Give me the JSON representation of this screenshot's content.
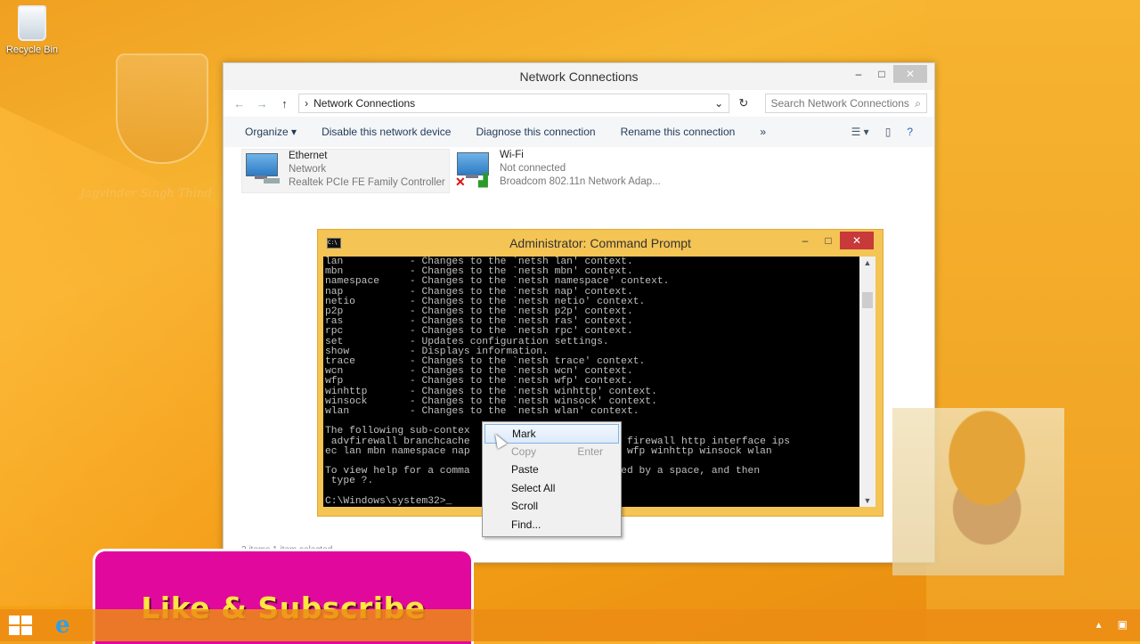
{
  "desktop": {
    "recycle_bin_label": "Recycle Bin",
    "watermark_text": "Jagvinder Singh Thind"
  },
  "explorer": {
    "title": "Network Connections",
    "breadcrumb": "Network Connections",
    "search_placeholder": "Search Network Connections",
    "commands": [
      "Organize ▾",
      "Disable this network device",
      "Diagnose this connection",
      "Rename this connection",
      "»"
    ],
    "items": [
      {
        "name": "Ethernet",
        "line2": "Network",
        "line3": "Realtek PCIe FE Family Controller"
      },
      {
        "name": "Wi-Fi",
        "line2": "Not connected",
        "line3": "Broadcom 802.11n Network Adap..."
      }
    ],
    "status": "2 items     1 item selected"
  },
  "cmd": {
    "title": "Administrator: Command Prompt",
    "output": "lan           - Changes to the `netsh lan' context.\nmbn           - Changes to the `netsh mbn' context.\nnamespace     - Changes to the `netsh namespace' context.\nnap           - Changes to the `netsh nap' context.\nnetio         - Changes to the `netsh netio' context.\np2p           - Changes to the `netsh p2p' context.\nras           - Changes to the `netsh ras' context.\nrpc           - Changes to the `netsh rpc' context.\nset           - Updates configuration settings.\nshow          - Displays information.\ntrace         - Changes to the `netsh trace' context.\nwcn           - Changes to the `netsh wcn' context.\nwfp           - Changes to the `netsh wfp' context.\nwinhttp       - Changes to the `netsh winhttp' context.\nwinsock       - Changes to the `netsh winsock' context.\nwlan          - Changes to the `netsh wlan' context.\n\nThe following sub-contex                                  \n advfirewall branchcache                 nsclient firewall http interface ips\nec lan mbn namespace nap                 race wcn wfp winhttp winsock wlan\n\nTo view help for a comma                 , followed by a space, and then\n type ?.\n\nC:\\Windows\\system32>_"
  },
  "context_menu": {
    "items": [
      {
        "label": "Mark",
        "accel": "",
        "state": "highlighted"
      },
      {
        "label": "Copy",
        "accel": "Enter",
        "state": "disabled"
      },
      {
        "label": "Paste",
        "accel": "",
        "state": "normal"
      },
      {
        "label": "Select All",
        "accel": "",
        "state": "normal"
      },
      {
        "label": "Scroll",
        "accel": "",
        "state": "normal"
      },
      {
        "label": "Find...",
        "accel": "",
        "state": "normal"
      }
    ]
  },
  "banner": {
    "text": "Like & Subscribe"
  },
  "colors": {
    "banner_bg": "#e1089e",
    "banner_text": "#ffe640",
    "cmd_frame": "#f4c454"
  },
  "icons": [
    "recycle-bin-icon",
    "back-icon",
    "forward-icon",
    "up-icon",
    "search-icon",
    "help-icon",
    "ethernet-icon",
    "wifi-icon",
    "cmd-icon",
    "start-icon",
    "ie-icon"
  ]
}
